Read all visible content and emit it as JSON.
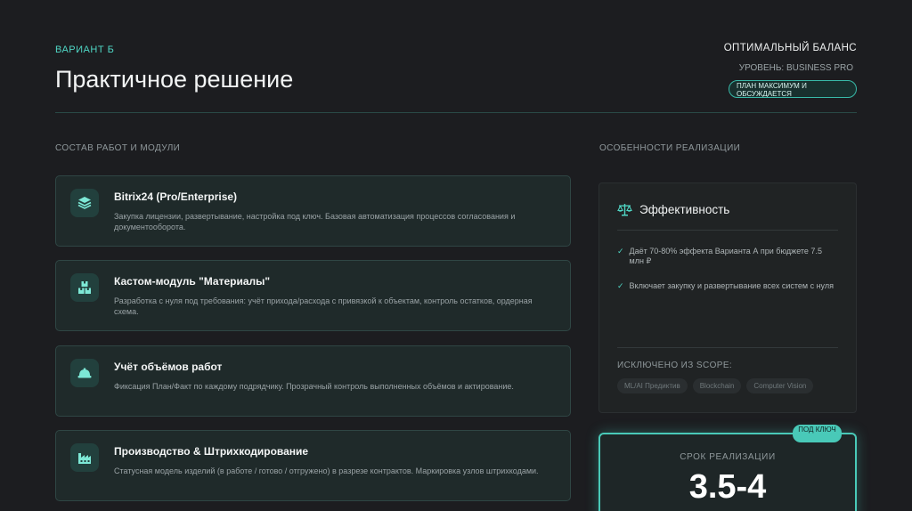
{
  "header": {
    "eyebrow": "ВАРИАНТ Б",
    "title": "Практичное решение",
    "right_title": "ОПТИМАЛЬНЫЙ БАЛАНС",
    "right_level": "УРОВЕНЬ: BUSINESS PRO",
    "right_pill": "ПЛАН МАКСИМУМ И ОБСУЖДАЕТСЯ"
  },
  "left_section_label": "СОСТАВ РАБОТ И МОДУЛИ",
  "right_section_label": "ОСОБЕННОСТИ РЕАЛИЗАЦИИ",
  "modules": [
    {
      "icon": "layers-icon",
      "title": "Bitrix24 (Pro/Enterprise)",
      "desc": "Закупка лицензии, развертывание, настройка под ключ. Базовая автоматизация процессов согласования и документооборота."
    },
    {
      "icon": "boxes-icon",
      "title": "Кастом-модуль \"Материалы\"",
      "desc": "Разработка с нуля под требования: учёт прихода/расхода с привязкой к объектам, контроль остатков, ордерная схема."
    },
    {
      "icon": "hard-hat-icon",
      "title": "Учёт объёмов работ",
      "desc": "Фиксация План/Факт по каждому подрядчику. Прозрачный контроль выполненных объёмов и актирование."
    },
    {
      "icon": "factory-icon",
      "title": "Производство & Штрихкодирование",
      "desc": "Статусная модель изделий (в работе / готово / отгружено) в разрезе контрактов. Маркировка узлов штрихкодами."
    }
  ],
  "efficiency": {
    "icon": "scales-icon",
    "title": "Эффективность",
    "points": [
      "Даёт 70-80% эффекта Варианта А при бюджете 7.5 млн ₽",
      "Включает закупку и развертывание всех систем с нуля"
    ],
    "excluded_label": "ИСКЛЮЧЕНО ИЗ SCOPE:",
    "excluded_tags": [
      "ML/AI Предиктив",
      "Blockchain",
      "Computer Vision"
    ]
  },
  "timeline": {
    "badge": "ПОД КЛЮЧ",
    "label": "СРОК РЕАЛИЗАЦИИ",
    "value": "3.5-4"
  },
  "colors": {
    "accent": "#4fd6c4",
    "background": "#1c1d20",
    "card": "#1f2a2a"
  }
}
